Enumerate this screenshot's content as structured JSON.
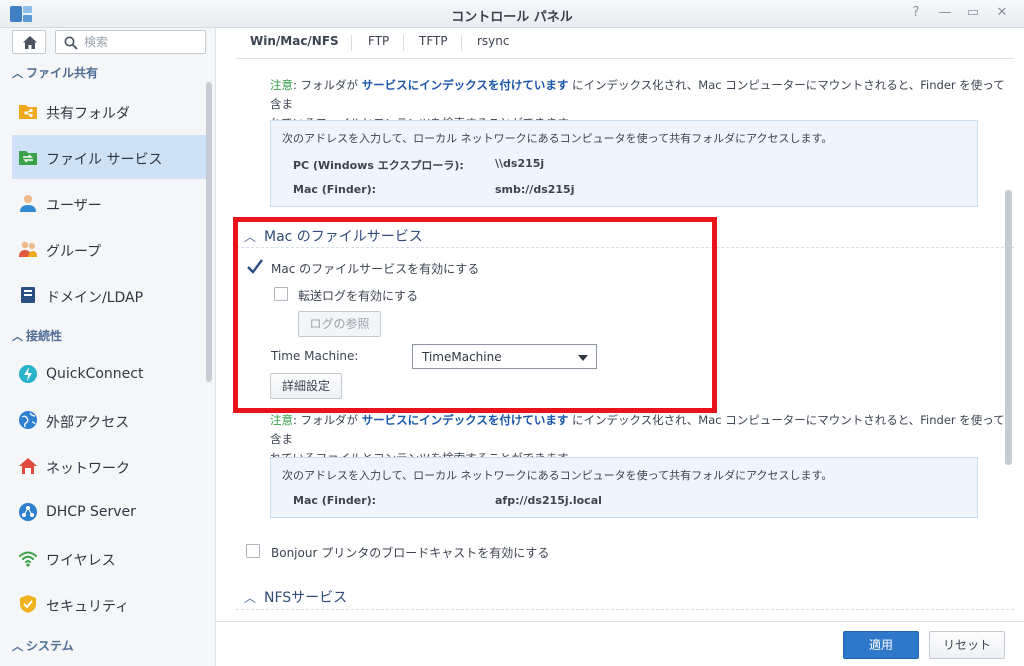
{
  "window": {
    "title": "コントロール パネル",
    "controls": {
      "help": "?",
      "minimize": "—",
      "maximize": "▭",
      "close": "✕"
    }
  },
  "sidebar": {
    "search_placeholder": "検索",
    "sections": [
      {
        "label": "ファイル共有"
      },
      {
        "label": "接続性"
      },
      {
        "label": "システム"
      }
    ],
    "items": [
      {
        "label": "共有フォルダ",
        "icon": "shared-folder-icon"
      },
      {
        "label": "ファイル サービス",
        "icon": "file-services-icon",
        "active": true
      },
      {
        "label": "ユーザー",
        "icon": "user-icon"
      },
      {
        "label": "グループ",
        "icon": "group-icon"
      },
      {
        "label": "ドメイン/LDAP",
        "icon": "domain-ldap-icon"
      },
      {
        "label": "QuickConnect",
        "icon": "quickconnect-icon"
      },
      {
        "label": "外部アクセス",
        "icon": "external-access-icon"
      },
      {
        "label": "ネットワーク",
        "icon": "network-icon"
      },
      {
        "label": "DHCP Server",
        "icon": "dhcp-icon"
      },
      {
        "label": "ワイヤレス",
        "icon": "wireless-icon"
      },
      {
        "label": "セキュリティ",
        "icon": "security-icon"
      }
    ]
  },
  "tabs": [
    {
      "label": "Win/Mac/NFS",
      "active": true
    },
    {
      "label": "FTP"
    },
    {
      "label": "TFTP"
    },
    {
      "label": "rsync"
    }
  ],
  "smb_note": {
    "prefix": "注意",
    "part1": ": フォルダが ",
    "emph": "サービスにインデックスを付けています",
    "part2": " にインデックス化され、Mac コンピューターにマウントされると、Finder を使って含ま",
    "line2": "れているファイルとコンテンツを検索することができます。"
  },
  "smb_info": {
    "intro": "次のアドレスを入力して、ローカル ネットワークにあるコンピュータを使って共有フォルダにアクセスします。",
    "rows": [
      {
        "key": "PC (Windows エクスプローラ):",
        "value": "\\\\ds215j"
      },
      {
        "key": "Mac (Finder):",
        "value": "smb://ds215j"
      }
    ]
  },
  "mac_section": {
    "title": "Mac のファイルサービス",
    "enable_label": "Mac のファイルサービスを有効にする",
    "enable_checked": true,
    "log_label": "転送ログを有効にする",
    "log_checked": false,
    "log_button": "ログの参照",
    "time_machine_label": "Time Machine:",
    "time_machine_value": "TimeMachine",
    "advanced_button": "詳細設定"
  },
  "afp_note": {
    "prefix": "注意",
    "part1": ": フォルダが ",
    "emph": "サービスにインデックスを付けています",
    "part2": " にインデックス化され、Mac コンピューターにマウントされると、Finder を使って含ま",
    "line2": "れているファイルとコンテンツを検索することができます。"
  },
  "afp_info": {
    "intro": "次のアドレスを入力して、ローカル ネットワークにあるコンピュータを使って共有フォルダにアクセスします。",
    "rows": [
      {
        "key": "Mac (Finder):",
        "value": "afp://ds215j.local"
      }
    ]
  },
  "bonjour": {
    "label": "Bonjour プリンタのブロードキャストを有効にする",
    "checked": false
  },
  "nfs_section": {
    "title": "NFSサービス"
  },
  "footer": {
    "apply": "適用",
    "reset": "リセット"
  },
  "colors": {
    "accent": "#2f77c8",
    "highlight": "#e8141b",
    "note_green": "#3aa04a",
    "note_blue": "#1a56a8"
  }
}
